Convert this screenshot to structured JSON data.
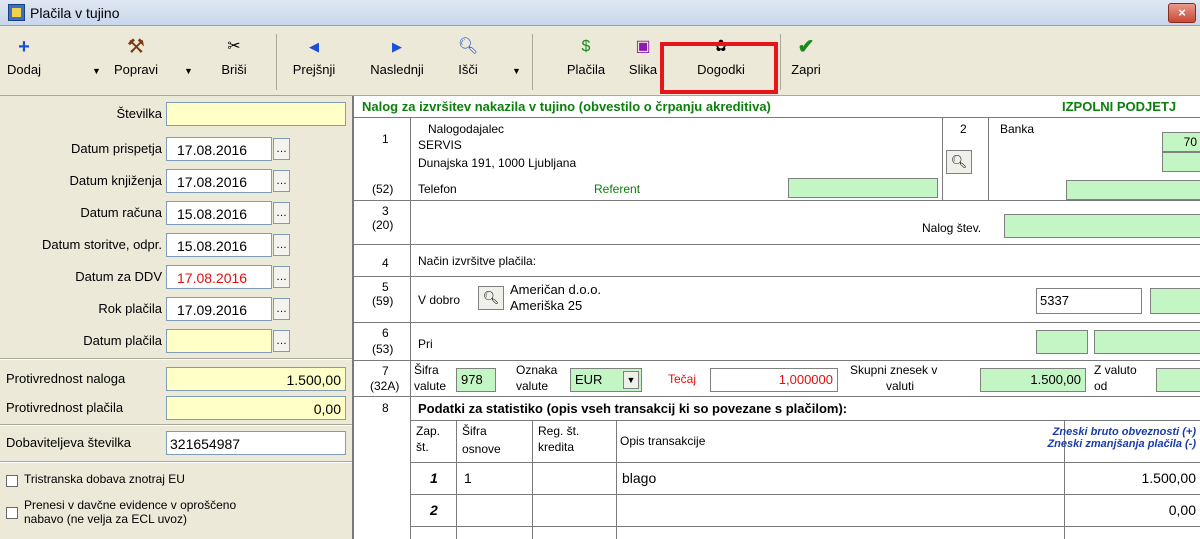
{
  "window": {
    "title": "Plačila v tujino",
    "close": "×"
  },
  "toolbar": {
    "add": "Dodaj",
    "edit": "Popravi",
    "delete": "Briši",
    "prev": "Prejšnji",
    "next": "Naslednji",
    "search": "Išči",
    "payments": "Plačila",
    "image": "Slika",
    "events": "Dogodki",
    "close": "Zapri"
  },
  "left": {
    "number_label": "Številka",
    "number_value": "",
    "dates": [
      {
        "label": "Datum prispetja",
        "value": "17.08.2016"
      },
      {
        "label": "Datum knjiženja",
        "value": "17.08.2016"
      },
      {
        "label": "Datum računa",
        "value": "15.08.2016"
      },
      {
        "label": "Datum storitve, odpr.",
        "value": "15.08.2016"
      },
      {
        "label": "Datum za DDV",
        "value": "17.08.2016"
      },
      {
        "label": "Rok plačila",
        "value": "17.09.2016"
      },
      {
        "label": "Datum plačila",
        "value": ""
      }
    ],
    "order_value_label": "Protivrednost naloga",
    "order_value": "1.500,00",
    "payment_value_label": "Protivrednost plačila",
    "payment_value": "0,00",
    "supplier_number_label": "Dobaviteljeva številka",
    "supplier_number": "321654987",
    "tripartite_label": "Tristranska dobava znotraj EU",
    "transfer_label_1": "Prenesi v davčne evidence v oproščeno",
    "transfer_label_2": "nabavo (ne velja za ECL uvoz)"
  },
  "form": {
    "header": "Nalog za izvršitev nakazila v tujino (obvestilo o črpanju akreditiva)",
    "header_right": "IZPOLNI PODJETJ",
    "s1": {
      "num": "1",
      "code": "(52)",
      "ordering_label": "Nalogodajalec",
      "name": "SERVIS",
      "address": "Dunajska 191, 1000  Ljubljana",
      "phone_label": "Telefon",
      "referent_label": "Referent"
    },
    "s2": {
      "num": "2",
      "bank_label": "Banka",
      "bank_value": "70"
    },
    "s3": {
      "num": "3",
      "code": "(20)",
      "order_no_label": "Nalog štev."
    },
    "s4": {
      "num": "4",
      "method_label": "Način izvršitve plačila:"
    },
    "s5": {
      "num": "5",
      "code": "(59)",
      "credit_label": "V dobro",
      "name": "Američan d.o.o.",
      "address": "Ameriška 25",
      "code_value": "5337"
    },
    "s6": {
      "num": "6",
      "code": "(53)",
      "at_label": "Pri"
    },
    "s7": {
      "num": "7",
      "code": "(32A)",
      "currency_code_label1": "Šifra",
      "currency_code_label2": "valute",
      "currency_code": "978",
      "currency_mark_label1": "Oznaka",
      "currency_mark_label2": "valute",
      "currency_mark": "EUR",
      "rate_label": "Tečaj",
      "rate": "1,000000",
      "total_label1": "Skupni znesek v",
      "total_label2": "valuti",
      "total": "1.500,00",
      "with_currency_label1": "Z valuto",
      "with_currency_label2": "od"
    },
    "s8": {
      "num": "8",
      "stat_title": "Podatki za statistiko (opis vseh transakcij ki so povezane s plačilom):"
    },
    "table": {
      "headers": {
        "no1": "Zap.",
        "no2": "št.",
        "code1": "Šifra",
        "code2": "osnove",
        "reg1": "Reg. št.",
        "reg2": "kredita",
        "desc": "Opis transakcije",
        "amt1": "Zneski bruto obveznosti (+)",
        "amt2": "Zneski zmanjšanja plačila (-)"
      },
      "rows": [
        {
          "no": "1",
          "code": "1",
          "reg": "",
          "desc": "blago",
          "amount": "1.500,00"
        },
        {
          "no": "2",
          "code": "",
          "reg": "",
          "desc": "",
          "amount": "0,00"
        }
      ]
    }
  }
}
